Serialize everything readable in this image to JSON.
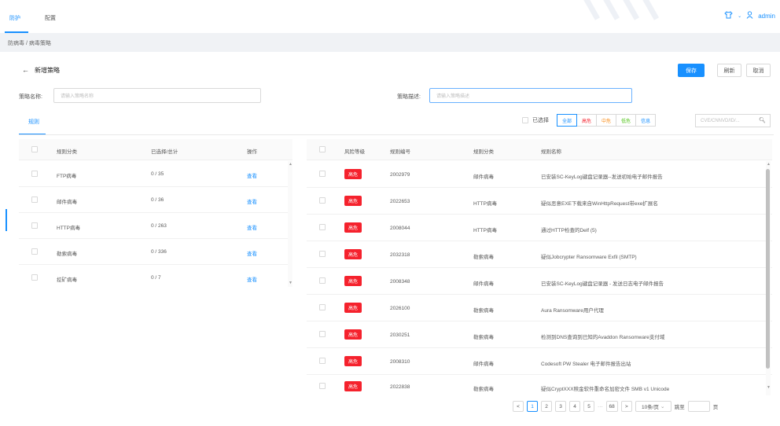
{
  "nav": {
    "item_protect": "防护",
    "item_config": "配置",
    "user": "admin"
  },
  "breadcrumb": "防病毒 / 病毒策略",
  "header": {
    "title": "新增策略",
    "save": "保存",
    "refresh": "刷新",
    "cancel": "取消"
  },
  "form": {
    "name_label": "策略名称:",
    "name_placeholder": "请输入策略名称",
    "desc_label": "策略描述:",
    "desc_placeholder": "请输入策略描述"
  },
  "tab": "规则",
  "filters": {
    "selected_label": "已选择",
    "options": [
      "全部",
      "高危",
      "中危",
      "低危",
      "信息"
    ],
    "active": "全部",
    "option_colors": [
      "#1890ff",
      "#f5222d",
      "#fa8c16",
      "#52c41a",
      "#1890ff"
    ],
    "search_placeholder": "CVE/CNNVD/ID/..."
  },
  "left_table": {
    "headers": [
      "规则分类",
      "已选择/总计",
      "操作"
    ],
    "rows": [
      {
        "category": "FTP病毒",
        "count": "0 / 35",
        "action": "查看"
      },
      {
        "category": "邮件病毒",
        "count": "0 / 36",
        "action": "查看"
      },
      {
        "category": "HTTP病毒",
        "count": "0 / 263",
        "action": "查看"
      },
      {
        "category": "勒索病毒",
        "count": "0 / 336",
        "action": "查看"
      },
      {
        "category": "挖矿病毒",
        "count": "0 / 7",
        "action": "查看"
      }
    ]
  },
  "right_table": {
    "headers": [
      "风险等级",
      "规则编号",
      "规则分类",
      "规则名称"
    ],
    "rows": [
      {
        "level": "高危",
        "id": "2002979",
        "category": "邮件病毒",
        "name": "已安装SC-KeyLog键盘记录器--发送初始电子邮件报告"
      },
      {
        "level": "高危",
        "id": "2022653",
        "category": "HTTP病毒",
        "name": "疑似恶意EXE下载来自WinHttpRequest带exe扩展名"
      },
      {
        "level": "高危",
        "id": "2008044",
        "category": "HTTP病毒",
        "name": "通过HTTP检查的Delf (5)"
      },
      {
        "level": "高危",
        "id": "2032318",
        "category": "勒索病毒",
        "name": "疑似Jobcrypter Ransomware Exfil (SMTP)"
      },
      {
        "level": "高危",
        "id": "2008348",
        "category": "邮件病毒",
        "name": "已安装SC-KeyLog键盘记录器 - 发送日志电子邮件报告"
      },
      {
        "level": "高危",
        "id": "2026100",
        "category": "勒索病毒",
        "name": "Aura Ransomware用户代理"
      },
      {
        "level": "高危",
        "id": "2030251",
        "category": "勒索病毒",
        "name": "检测到DNS查询到已知的Avaddon Ransomware支付域"
      },
      {
        "level": "高危",
        "id": "2008310",
        "category": "邮件病毒",
        "name": "Codesoft PW Stealer 电子邮件报告出站"
      },
      {
        "level": "高危",
        "id": "2022838",
        "category": "勒索病毒",
        "name": "疑似CryptXXX赎金软件重命名加密文件 SMB v1 Unicode"
      }
    ]
  },
  "pagination": {
    "prev": "<",
    "pages": [
      "1",
      "2",
      "3",
      "4",
      "5"
    ],
    "ellipsis": "···",
    "last": "68",
    "next": ">",
    "size": "10条/页",
    "jump": "跳至",
    "unit": "页",
    "current": "1"
  },
  "colors": {
    "accent": "#1890ff",
    "danger": "#f5222d"
  }
}
